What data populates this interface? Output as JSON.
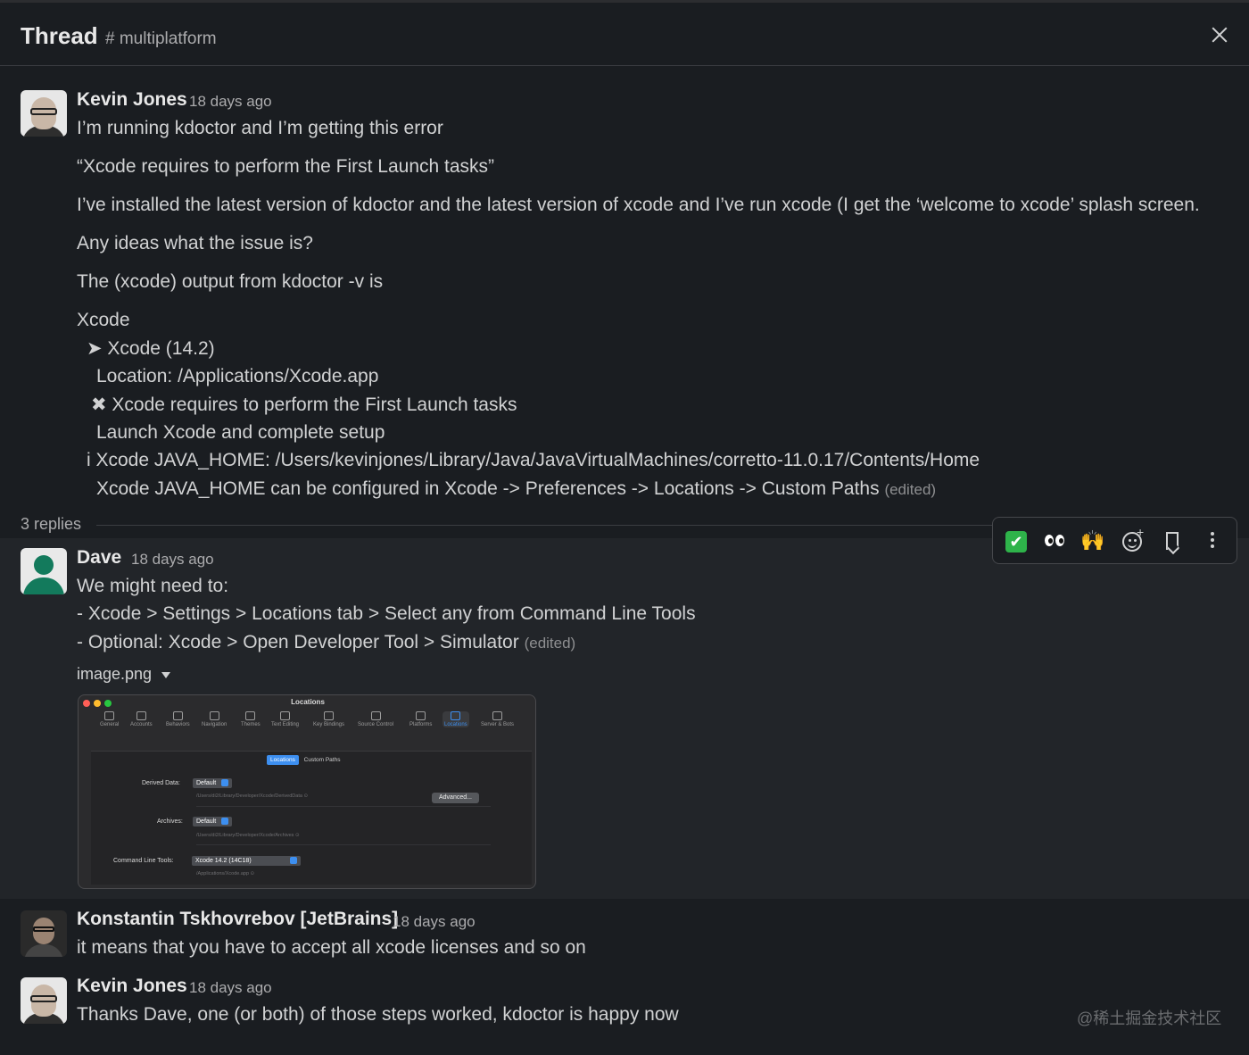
{
  "header": {
    "title": "Thread",
    "channel": "# multiplatform"
  },
  "parent": {
    "author": "Kevin Jones",
    "time": "18 days ago",
    "lines": [
      "I’m running kdoctor and I’m getting this error",
      "“Xcode requires to perform the First Launch tasks”",
      "I’ve installed the latest version of kdoctor and the latest version of xcode and I’ve run xcode (I get the ‘welcome to xcode’ splash screen.",
      "Any ideas what the issue is?",
      "The (xcode) output from kdoctor -v is",
      "Xcode",
      "➤ Xcode (14.2)",
      "Location: /Applications/Xcode.app",
      "✖ Xcode requires to perform the First Launch tasks",
      "Launch Xcode and complete setup",
      "i Xcode JAVA_HOME: /Users/kevinjones/Library/Java/JavaVirtualMachines/corretto-11.0.17/Contents/Home",
      "Xcode JAVA_HOME can be configured in Xcode -> Preferences -> Locations -> Custom Paths"
    ],
    "edited": "(edited)"
  },
  "replies_count": "3 replies",
  "toolbar": {
    "check_glyph": "✔",
    "hands_glyph": "🙌",
    "react_plus": "+",
    "icons": [
      "white-check-mark-icon",
      "eyes-icon",
      "raised-hands-icon",
      "add-reaction-icon",
      "bookmark-icon",
      "more-actions-icon"
    ]
  },
  "reply1": {
    "author": "Dave",
    "time": "18 days ago",
    "lines": [
      "We might need to:",
      "- Xcode > Settings > Locations tab > Select any from Command Line Tools",
      "- Optional: Xcode > Open Developer Tool > Simulator"
    ],
    "edited": "(edited)",
    "file_name": "image.png",
    "screenshot": {
      "window_title": "Locations",
      "tabs": [
        "General",
        "Accounts",
        "Behaviors",
        "Navigation",
        "Themes",
        "Text Editing",
        "Key Bindings",
        "Source Control",
        "Platforms",
        "Locations",
        "Server & Bots"
      ],
      "active_tab": "Locations",
      "segments": [
        "Locations",
        "Custom Paths"
      ],
      "derived_data_label": "Derived Data:",
      "derived_data_value": "Default",
      "derived_data_path": "/Users/di2/Library/Developer/Xcode/DerivedData ⊙",
      "advanced_button": "Advanced...",
      "archives_label": "Archives:",
      "archives_value": "Default",
      "archives_path": "/Users/di2/Library/Developer/Xcode/Archives ⊙",
      "clt_label": "Command Line Tools:",
      "clt_value": "Xcode 14.2 (14C18)",
      "clt_path": "/Applications/Xcode.app ⊙"
    }
  },
  "reply2": {
    "author": "Konstantin Tskhovrebov [JetBrains]",
    "time": "18 days ago",
    "text": "it means that you have to accept all xcode licenses and so on"
  },
  "reply3": {
    "author": "Kevin Jones",
    "time": "18 days ago",
    "text": "Thanks Dave, one (or both) of those steps worked, kdoctor is happy now"
  },
  "watermark": "@稀土掘金技术社区",
  "colors": {
    "background": "#1a1d21",
    "hover": "#222529",
    "accent_blue": "#3d8ff0",
    "check_green": "#2eb34a"
  }
}
